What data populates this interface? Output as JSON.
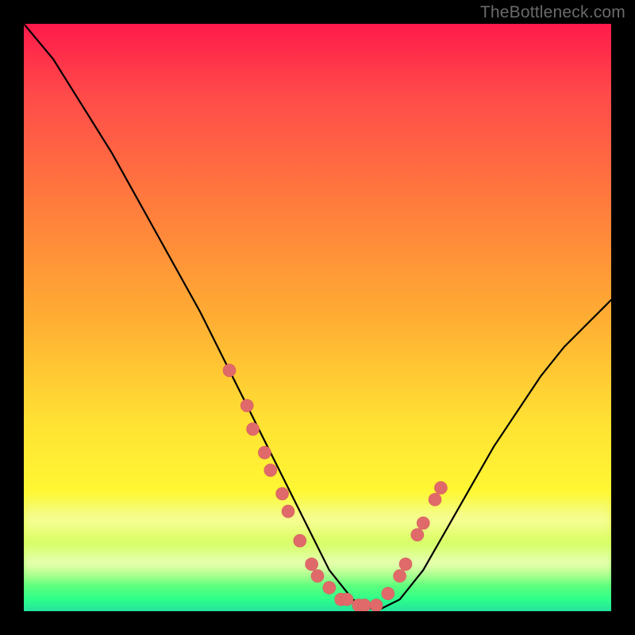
{
  "watermark": "TheBottleneck.com",
  "colors": {
    "gradient_top": "#ff1a4b",
    "gradient_mid1": "#ff7a3d",
    "gradient_mid2": "#ffe233",
    "gradient_bottom": "#2eff8a",
    "curve": "#000000",
    "dot": "#e06a6a",
    "frame": "#000000"
  },
  "chart_data": {
    "type": "line",
    "title": "",
    "xlabel": "",
    "ylabel": "",
    "xlim": [
      0,
      100
    ],
    "ylim": [
      0,
      100
    ],
    "comment": "V-shaped bottleneck curve. y=100 at left edge, dips to ~0 around x≈50–60, rises to ~53 at right edge. Approximate values read from pixel positions; no axis ticks shown.",
    "series": [
      {
        "name": "bottleneck-curve",
        "x": [
          0,
          5,
          10,
          15,
          20,
          25,
          30,
          35,
          40,
          44,
          48,
          52,
          56,
          60,
          64,
          68,
          72,
          76,
          80,
          84,
          88,
          92,
          96,
          100
        ],
        "y": [
          100,
          94,
          86,
          78,
          69,
          60,
          51,
          41,
          31,
          23,
          15,
          7,
          2,
          0,
          2,
          7,
          14,
          21,
          28,
          34,
          40,
          45,
          49,
          53
        ]
      }
    ],
    "markers": {
      "name": "highlighted-points",
      "comment": "Salmon dots clustered on the lower arms and trough of the V.",
      "points": [
        {
          "x": 35,
          "y": 41
        },
        {
          "x": 38,
          "y": 35
        },
        {
          "x": 39,
          "y": 31
        },
        {
          "x": 41,
          "y": 27
        },
        {
          "x": 42,
          "y": 24
        },
        {
          "x": 44,
          "y": 20
        },
        {
          "x": 45,
          "y": 17
        },
        {
          "x": 47,
          "y": 12
        },
        {
          "x": 49,
          "y": 8
        },
        {
          "x": 50,
          "y": 6
        },
        {
          "x": 52,
          "y": 4
        },
        {
          "x": 54,
          "y": 2
        },
        {
          "x": 55,
          "y": 2
        },
        {
          "x": 57,
          "y": 1
        },
        {
          "x": 58,
          "y": 1
        },
        {
          "x": 60,
          "y": 1
        },
        {
          "x": 62,
          "y": 3
        },
        {
          "x": 64,
          "y": 6
        },
        {
          "x": 65,
          "y": 8
        },
        {
          "x": 67,
          "y": 13
        },
        {
          "x": 68,
          "y": 15
        },
        {
          "x": 70,
          "y": 19
        },
        {
          "x": 71,
          "y": 21
        }
      ]
    }
  }
}
